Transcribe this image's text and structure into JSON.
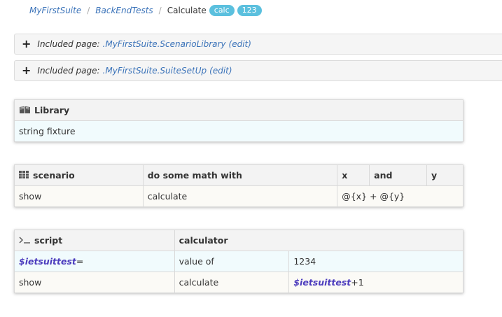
{
  "breadcrumb": {
    "items": [
      "MyFirstSuite",
      "BackEndTests"
    ],
    "current": "Calculate",
    "badges": [
      "calc",
      "123"
    ]
  },
  "included_pages": [
    {
      "label": "Included page:",
      "link": ".MyFirstSuite.ScenarioLibrary",
      "edit": "(edit)"
    },
    {
      "label": "Included page:",
      "link": ".MyFirstSuite.SuiteSetUp",
      "edit": "(edit)"
    }
  ],
  "library_table": {
    "header": "Library",
    "rows": [
      "string fixture"
    ]
  },
  "scenario_table": {
    "header": [
      "scenario",
      "do some math with",
      "x",
      "and",
      "y"
    ],
    "row": [
      "show",
      "calculate",
      "@{x} + @{y}"
    ]
  },
  "script_table": {
    "header": [
      "script",
      "calculator"
    ],
    "row1": {
      "symbol": "$ietsuittest",
      "suffix": "=",
      "col2": "value of",
      "col3": "1234"
    },
    "row2": {
      "col1": "show",
      "col2": "calculate",
      "symbol": "$ietsuittest",
      "suffix": "+1"
    }
  },
  "colors": {
    "link": "#3b73b9",
    "badge": "#5bc0de",
    "symbol": "#4b3bbd"
  },
  "icons": {
    "library": "book-icon",
    "scenario": "grid-icon",
    "script": "terminal-icon",
    "included": "plus-icon"
  }
}
